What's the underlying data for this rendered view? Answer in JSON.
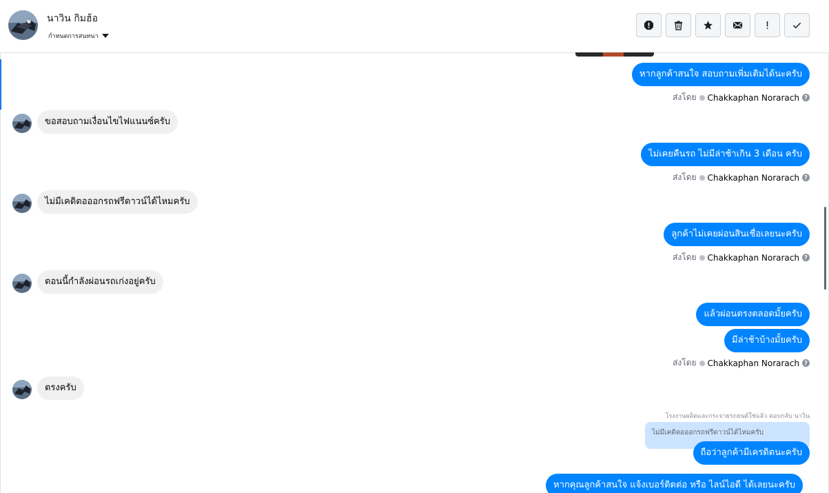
{
  "header": {
    "name": "นาวิน กิมฮ้อ",
    "subtitle": "กำหนดการสนทนา",
    "actions": [
      "report-icon",
      "trash-icon",
      "star-icon",
      "mail-icon",
      "exclamation-icon",
      "check-icon"
    ]
  },
  "sent_by": {
    "prefix": "ส่งโดย",
    "agent": "Chakkaphan Norarach",
    "help": "?"
  },
  "messages": {
    "m1": "หากลูกค้าสนใจ สอบถามเพิ่มเติมได้นะครับ",
    "m2": "ขอสอบถามเงื่อนไขไฟแนนซ์ครับ",
    "m3": "ไม่เคยคืนรถ ไม่มีล่าช้าเกิน 3 เดือน ครับ",
    "m4": "ไม่มีเคดิตอออกรถฟรีดาวน์ได้ไหมครับ",
    "m5": "ลูกค้าไม่เคยผ่อนสินเชื่อเลยนะครับ",
    "m6": "ตอนนี้กำลังผ่อนรถเก่งอยู่ครับ",
    "m7": "แล้วผ่อนตรงตลอดมั้ยครับ",
    "m8": "มีล่าช้าบ้างมั้ยครับ",
    "m9": "ตรงครับ",
    "reply_note": "โรงงานผลิตและกระจายรถยนต์ใช่แล้ว ตอบกลับ นาวิน",
    "reply_quote": "ไม่มีเคดิตอออกรถฟรีดาวน์ได้ไหมครับ",
    "m10": "ถือว่าลูกค้ามีเครดิตนะครับ",
    "m11": "หากคุณลูกค้าสนใจ แจ้งเบอร์ติดต่อ หรือ ไลน์ไอดี ได้เลยนะครับ"
  },
  "colors": {
    "outgoing": "#0084ff",
    "incoming": "#f0f0f0",
    "reply_quote": "#cce4ff",
    "accent": "#1877f2"
  }
}
